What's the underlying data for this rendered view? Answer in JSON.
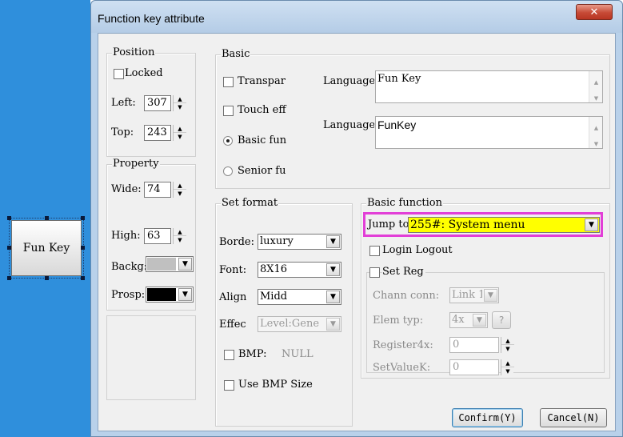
{
  "canvas": {
    "fun_key_label": "Fun Key"
  },
  "dialog": {
    "title": "Function key attribute",
    "close_icon": "close-icon"
  },
  "position": {
    "legend": "Position",
    "locked_label": "Locked",
    "locked_checked": false,
    "left_label": "Left:",
    "left_value": "307",
    "top_label": "Top:",
    "top_value": "243"
  },
  "property": {
    "legend": "Property",
    "wide_label": "Wide:",
    "wide_value": "74",
    "high_label": "High:",
    "high_value": "63",
    "backg_label": "Backg:",
    "backg_color": "#c0c0c0",
    "prosp_label": "Prosp:",
    "prosp_color": "#000000"
  },
  "basic": {
    "legend": "Basic",
    "transpar_label": "Transpar",
    "touch_label": "Touch eff",
    "basic_fun_label": "Basic fun",
    "senior_fu_label": "Senior fu",
    "selected_mode": "Basic fun",
    "language1_label": "Language",
    "language1_text": "Fun Key",
    "language2_label": "Language",
    "language2_text": "FunKey"
  },
  "set_format": {
    "legend": "Set format",
    "border_label": "Borde:",
    "border_value": "luxury",
    "font_label": "Font:",
    "font_value": "8X16",
    "align_label": "Align",
    "align_value": "Midd",
    "effect_label": "Effec",
    "effect_value": "Level:Gene",
    "bmp_label": "BMP:",
    "bmp_value": "NULL",
    "use_bmp_size_label": "Use BMP Size"
  },
  "basic_function": {
    "legend": "Basic function",
    "jump_to_label": "Jump to",
    "jump_to_value": "255#: System menu",
    "highlight_border": "#e23fd7",
    "highlight_fill": "#ffff00",
    "login_logout_label": "Login Logout",
    "set_reg_label": "Set Reg",
    "chann_conn_label": "Chann conn:",
    "chann_conn_value": "Link 1",
    "elem_typ_label": "Elem typ:",
    "elem_typ_value": "4x",
    "elem_help_label": "?",
    "register4x_label": "Register4x:",
    "register4x_value": "0",
    "setvaluek_label": "SetValueK:",
    "setvaluek_value": "0"
  },
  "buttons": {
    "confirm": "Confirm(Y)",
    "cancel": "Cancel(N)"
  }
}
